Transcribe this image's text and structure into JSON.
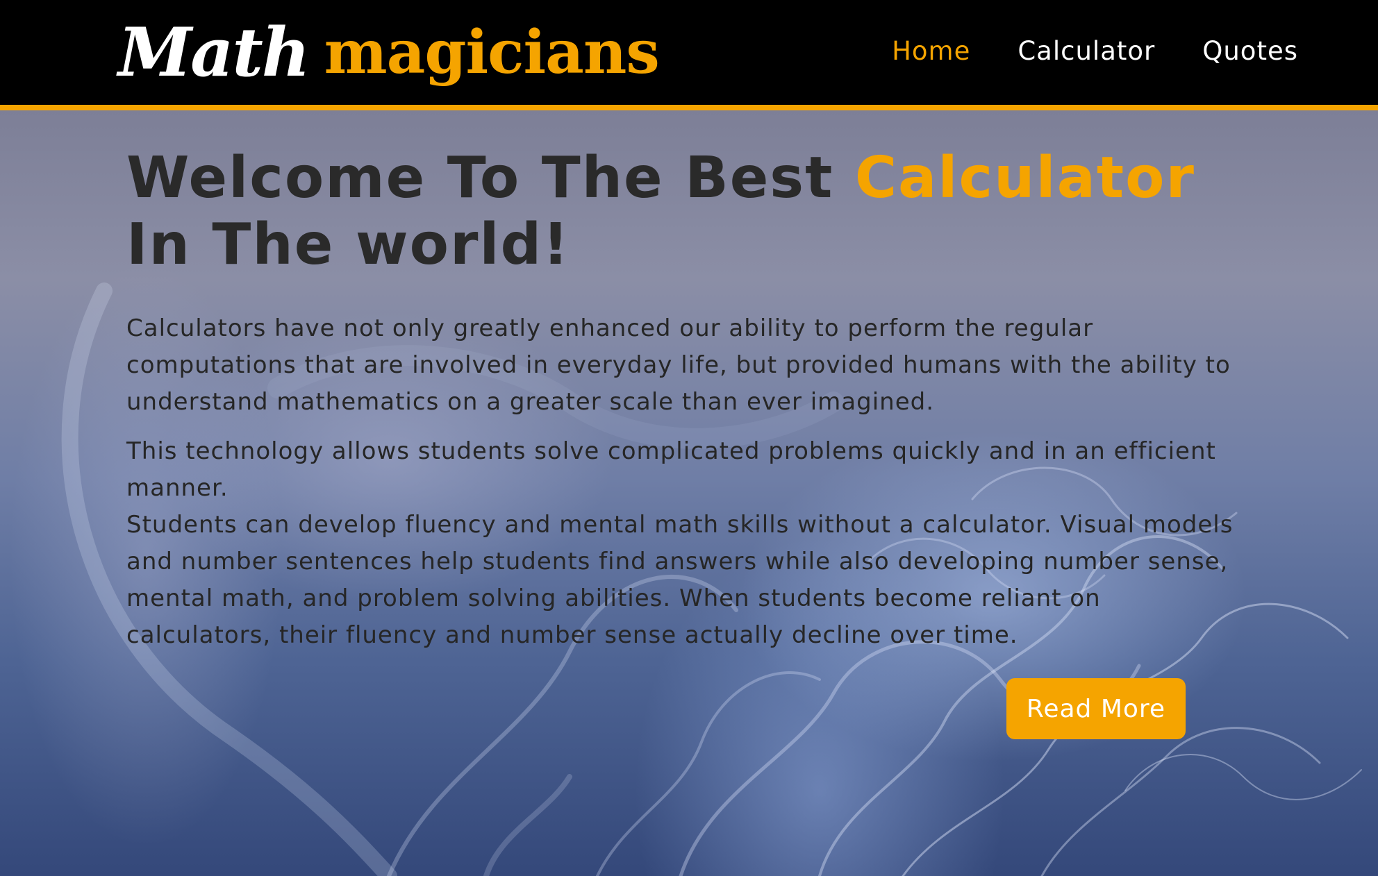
{
  "header": {
    "logo": {
      "part1": "Math",
      "part2": "magicians"
    },
    "nav": [
      {
        "label": "Home",
        "active": true
      },
      {
        "label": "Calculator",
        "active": false
      },
      {
        "label": "Quotes",
        "active": false
      }
    ]
  },
  "hero": {
    "headline_before": "Welcome To The Best ",
    "headline_accent": "Calculator",
    "headline_after": " In The world!",
    "paragraph1": "Calculators have not only greatly enhanced our ability to perform the regular computations that are involved in everyday life, but provided humans with the ability to understand mathematics on a greater scale than ever imagined.",
    "paragraph2_line1": "This technology allows students solve complicated problems quickly and in an efficient manner.",
    "paragraph2_line2": "Students can develop fluency and mental math skills without a calculator. Visual models and number sentences help students find answers while also developing number sense, mental math, and problem solving abilities. When students become reliant on calculators, their fluency and number sense actually decline over time.",
    "cta_label": "Read More"
  },
  "colors": {
    "accent": "#f5a400",
    "navbar_bg": "#000000",
    "text_dark": "#262626"
  }
}
